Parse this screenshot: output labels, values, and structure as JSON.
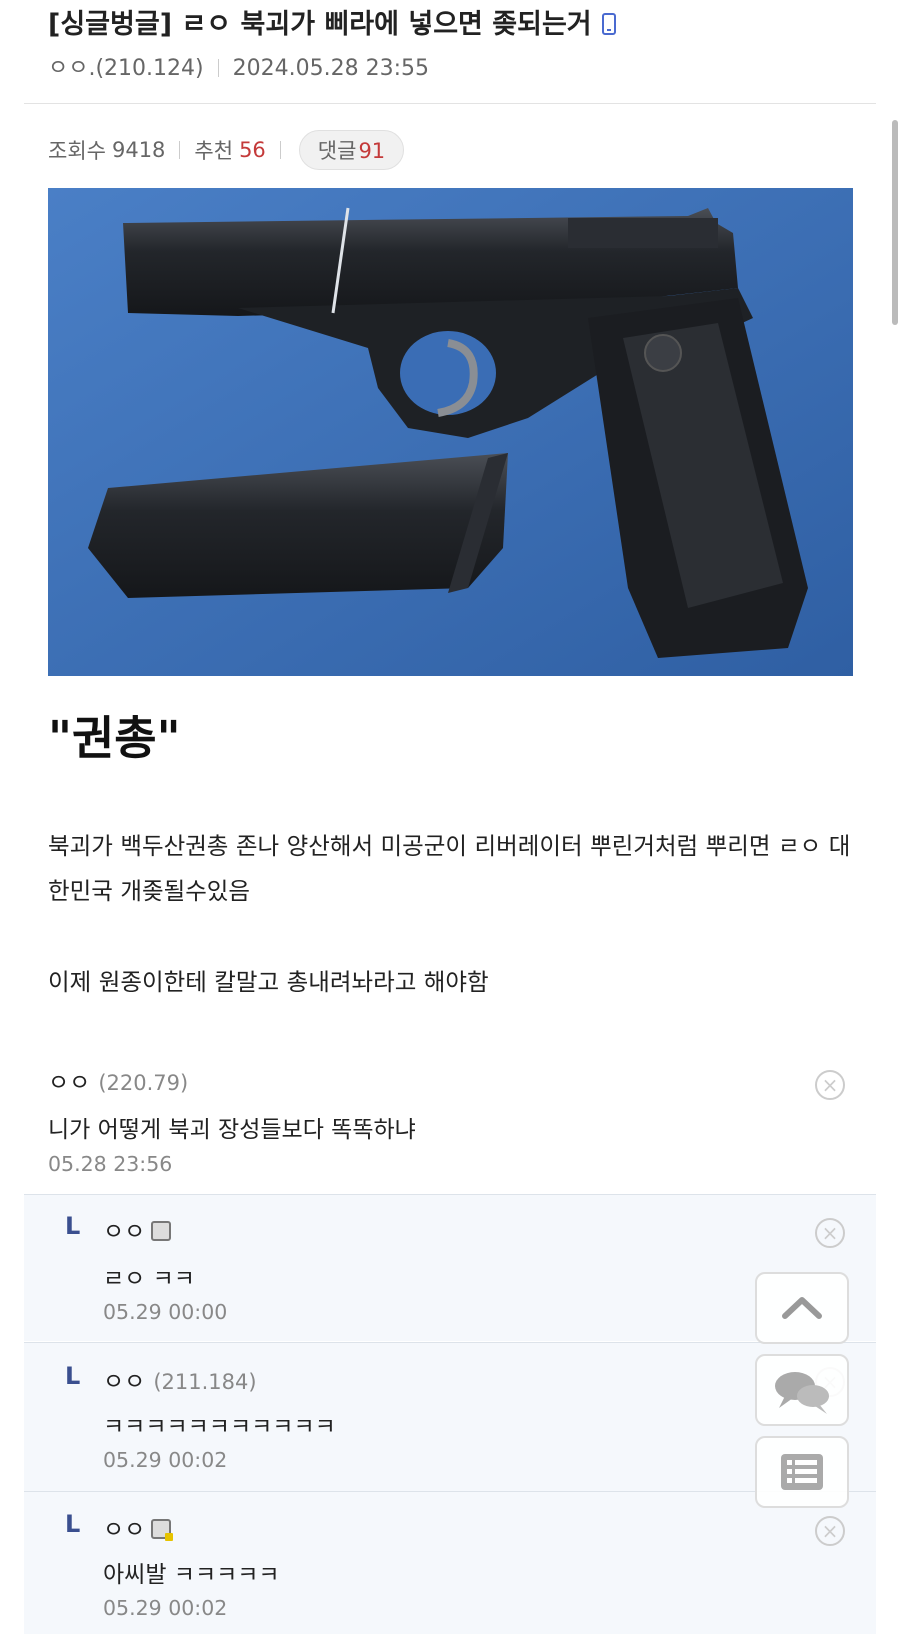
{
  "post": {
    "title": "[싱글벙글] ㄹㅇ 북괴가 삐라에 넣으면 좆되는거",
    "author": "ㅇㅇ.(210.124)",
    "date": "2024.05.28 23:55",
    "views_label": "조회수",
    "views": "9418",
    "recommend_label": "추천",
    "recommend": "56",
    "comments_label": "댓글",
    "comments": "91",
    "headline": "\"권총\"",
    "paragraph1": "북괴가 백두산권총 존나 양산해서 미공군이 리버레이터 뿌린거처럼 뿌리면 ㄹㅇ 대한민국 개좆될수있음",
    "paragraph2": "이제 원종이한테 칼말고 총내려놔라고 해야함"
  },
  "comments": [
    {
      "name": "ㅇㅇ",
      "ip": "(220.79)",
      "text": "니가 어떻게 북괴 장성들보다 똑똑하냐",
      "date": "05.28 23:56"
    },
    {
      "name": "ㅇㅇ",
      "ip": "",
      "text": "ㄹㅇ ㅋㅋ",
      "date": "05.29 00:00"
    },
    {
      "name": "ㅇㅇ",
      "ip": "(211.184)",
      "text": "ㅋㅋㅋㅋㅋㅋㅋㅋㅋㅋㅋ",
      "date": "05.29 00:02"
    },
    {
      "name": "ㅇㅇ",
      "ip": "",
      "text": "아씨발 ㅋㅋㅋㅋㅋ",
      "date": "05.29 00:02"
    }
  ],
  "reply_marker": "L",
  "close_glyph": "×",
  "icons": [
    "mobile-icon",
    "close-icon",
    "memo-icon",
    "arrow-up-icon",
    "comment-bubble-icon",
    "list-icon"
  ],
  "colors": {
    "accent_red": "#c43a3a",
    "reply_bg": "#f5f8fc",
    "photo_bg": "#3a6db5"
  }
}
